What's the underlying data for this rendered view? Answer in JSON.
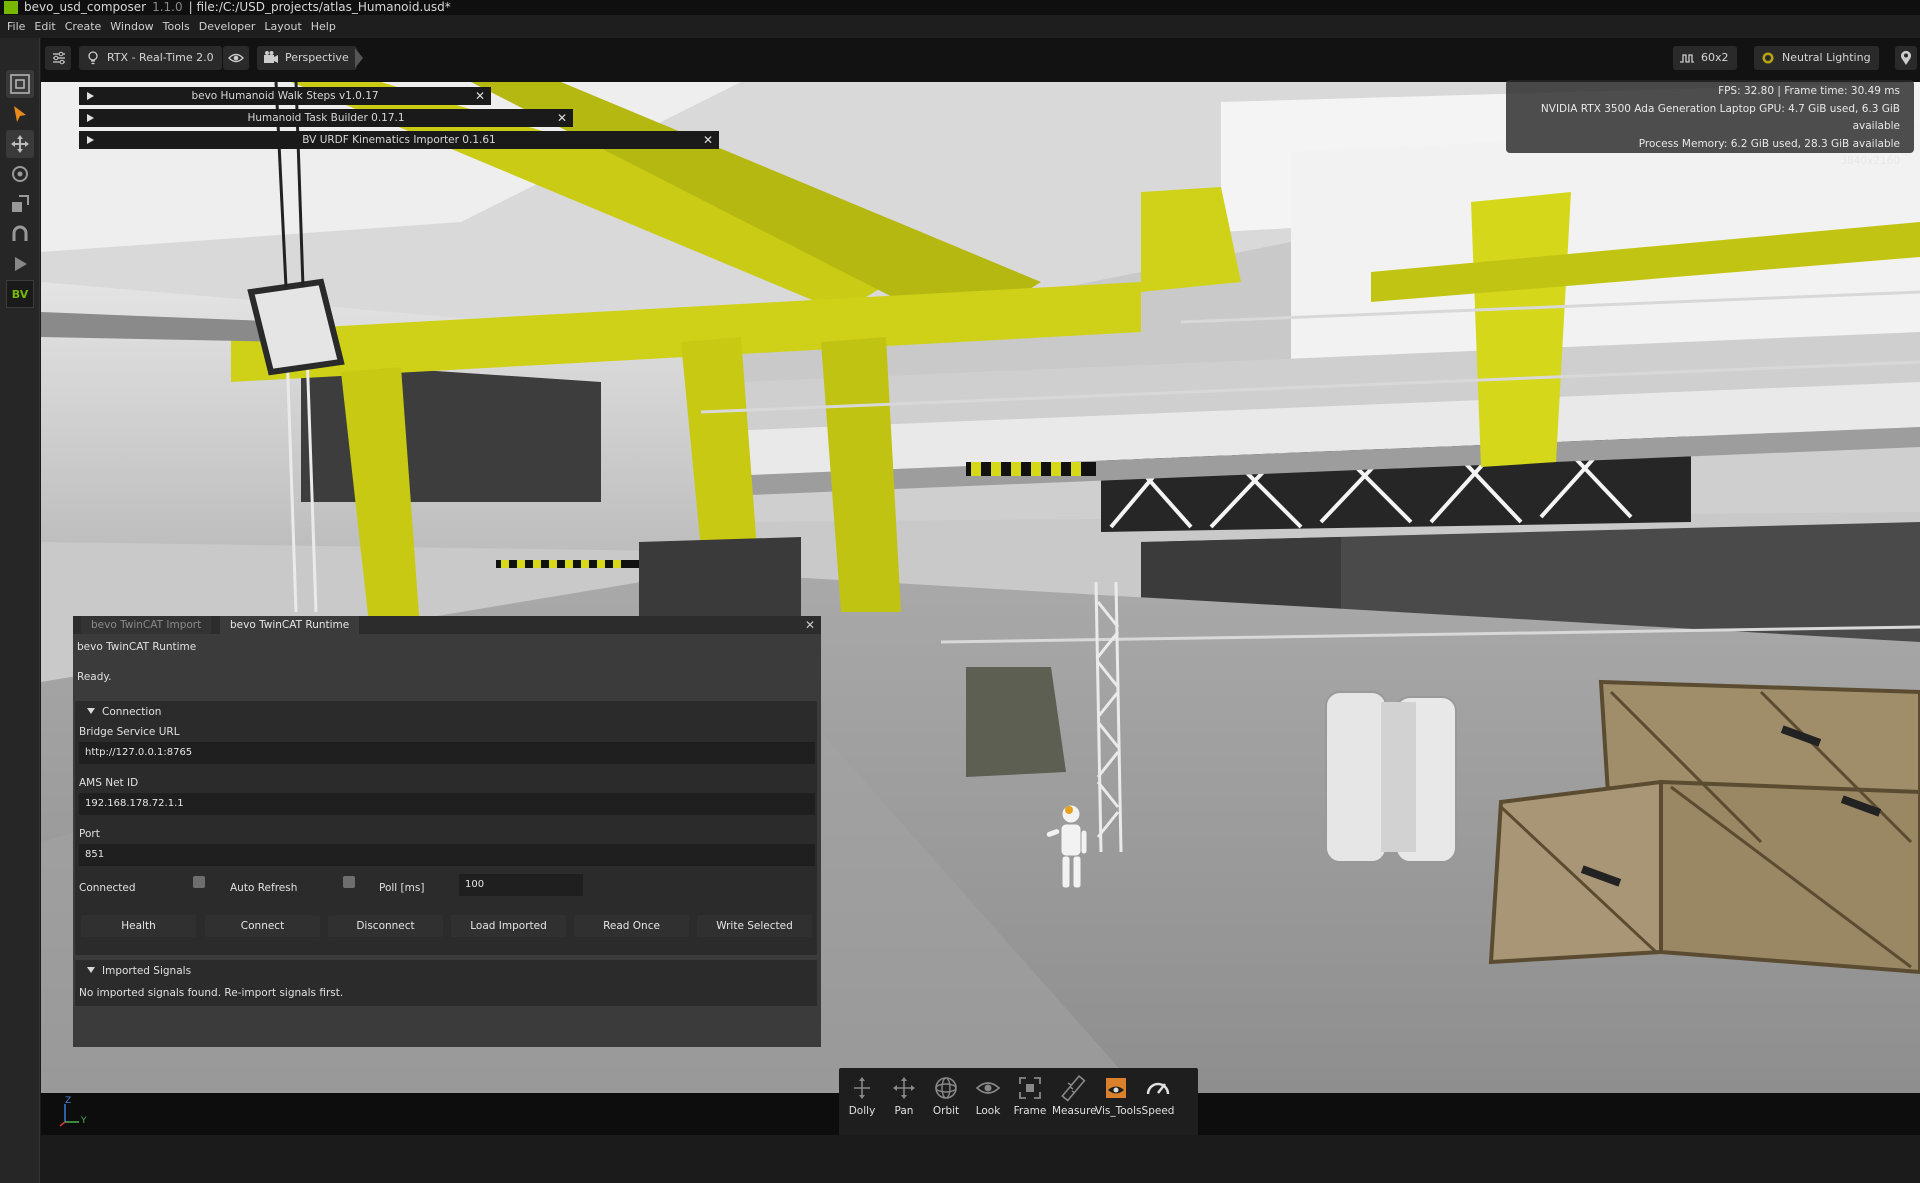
{
  "titlebar": {
    "app_name": "bevo_usd_composer",
    "version": "1.1.0",
    "file": "file:/C:/USD_projects/atlas_Humanoid.usd*"
  },
  "menu": [
    "File",
    "Edit",
    "Create",
    "Window",
    "Tools",
    "Developer",
    "Layout",
    "Help"
  ],
  "left_toolbar": {
    "icons": [
      "viewport-settings-icon",
      "select-icon",
      "move-icon",
      "rotate-icon",
      "scale-icon",
      "snap-icon",
      "play-icon"
    ],
    "bv_logo": "BV"
  },
  "viewport": {
    "renderer": "RTX - Real-Time 2.0",
    "camera": "Perspective",
    "resolution_btn": "60x2",
    "lighting": "Neutral Lighting",
    "stats": {
      "fps_line": "FPS: 32.80 | Frame time: 30.49 ms",
      "gpu_line": "NVIDIA RTX 3500 Ada Generation Laptop GPU: 4.7 GiB used, 6.3 GiB available",
      "memory_line": "Process Memory: 6.2 GiB used, 28.3 GiB available",
      "resolution": "3840x2160"
    },
    "axis": {
      "z": "Z",
      "y": "Y"
    }
  },
  "extensions": [
    {
      "label": "bevo Humanoid Walk Steps v1.0.17"
    },
    {
      "label": "Humanoid Task Builder 0.17.1"
    },
    {
      "label": "BV URDF Kinematics Importer 0.1.61"
    }
  ],
  "panel": {
    "tabs": [
      "bevo TwinCAT Import",
      "bevo TwinCAT Runtime"
    ],
    "title": "bevo TwinCAT Runtime",
    "status": "Ready.",
    "connection": {
      "header": "Connection",
      "bridge_label": "Bridge Service URL",
      "bridge_value": "http://127.0.0.1:8765",
      "ams_label": "AMS Net ID",
      "ams_value": "192.168.178.72.1.1",
      "port_label": "Port",
      "port_value": "851",
      "connected_label": "Connected",
      "auto_refresh_label": "Auto Refresh",
      "poll_label": "Poll [ms]",
      "poll_value": "100"
    },
    "buttons": [
      "Health",
      "Connect",
      "Disconnect",
      "Load Imported",
      "Read Once",
      "Write Selected"
    ],
    "signals": {
      "header": "Imported Signals",
      "empty": "No imported signals found. Re-import signals first."
    }
  },
  "dock": [
    {
      "label": "Dolly",
      "icon": "dolly-icon"
    },
    {
      "label": "Pan",
      "icon": "pan-icon"
    },
    {
      "label": "Orbit",
      "icon": "orbit-icon"
    },
    {
      "label": "Look",
      "icon": "look-icon"
    },
    {
      "label": "Frame",
      "icon": "frame-icon"
    },
    {
      "label": "Measure",
      "icon": "measure-icon"
    },
    {
      "label": "Vis_Tools",
      "icon": "vis-tools-icon"
    },
    {
      "label": "Speed",
      "icon": "speed-icon"
    }
  ],
  "colors": {
    "accent": "#76b900",
    "structure_yellow": "#d4d61a",
    "panel_bg": "#3b3b3b",
    "field_bg": "#1f1f1f"
  }
}
